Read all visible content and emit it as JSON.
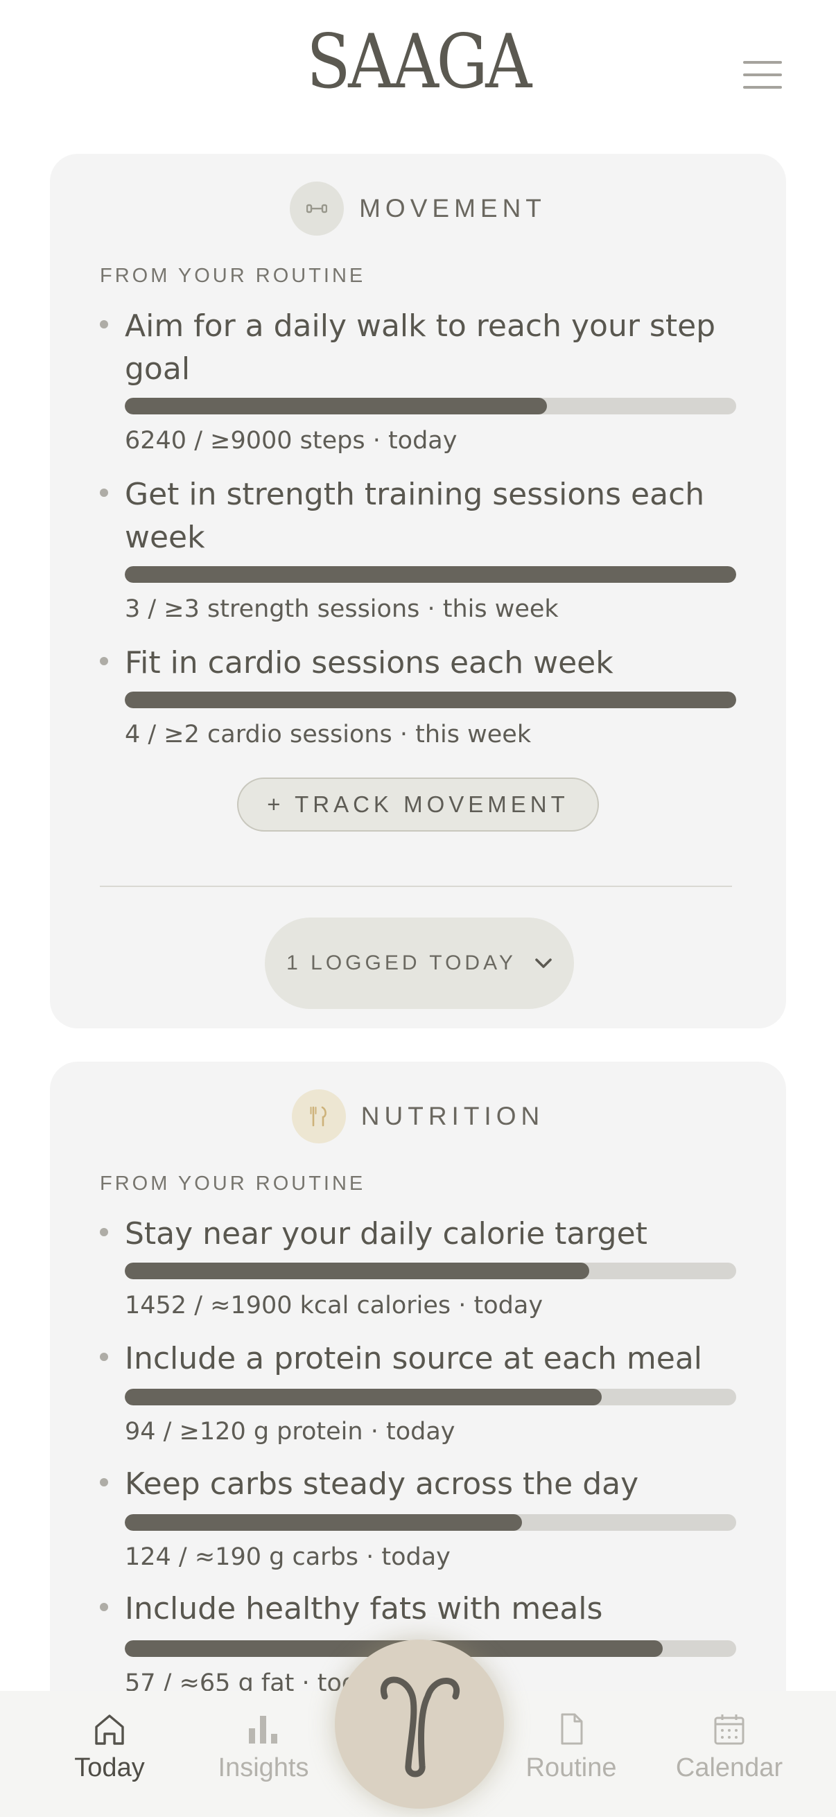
{
  "app": {
    "logo": "SAAGA"
  },
  "movement": {
    "title": "MOVEMENT",
    "section_label": "FROM YOUR ROUTINE",
    "goals": [
      {
        "text": "Aim for a daily walk to reach your step goal",
        "meta": "6240 / ≥9000 steps · today",
        "progress": 0.69
      },
      {
        "text": "Get in strength training sessions each week",
        "meta": "3 / ≥3 strength sessions · this week",
        "progress": 1.0
      },
      {
        "text": "Fit in cardio sessions each week",
        "meta": "4 / ≥2 cardio sessions · this week",
        "progress": 1.0
      }
    ],
    "track_button": "+ TRACK MOVEMENT",
    "logged_button": "1 LOGGED TODAY"
  },
  "nutrition": {
    "title": "NUTRITION",
    "section_label": "FROM YOUR ROUTINE",
    "goals": [
      {
        "text": "Stay near your daily calorie target",
        "meta": "1452 / ≈1900 kcal calories · today",
        "progress": 0.76
      },
      {
        "text": "Include a protein source at each meal",
        "meta": "94 / ≥120 g protein · today",
        "progress": 0.78
      },
      {
        "text": "Keep carbs steady across the day",
        "meta": "124 / ≈190 g carbs · today",
        "progress": 0.65
      },
      {
        "text": "Include healthy fats with meals",
        "meta": "57 / ≈65 g fat · today",
        "progress": 0.88
      }
    ]
  },
  "nav": {
    "items": [
      {
        "label": "Today",
        "active": true
      },
      {
        "label": "Insights",
        "active": false
      },
      {
        "label": "Routine",
        "active": false
      },
      {
        "label": "Calendar",
        "active": false
      }
    ]
  },
  "colors": {
    "accent": "#67645c",
    "track": "#d6d5d1",
    "card": "#f4f4f4",
    "fab": "#dad1c2"
  },
  "icons": {
    "movement": "dumbbell-icon",
    "nutrition": "fork-knife-icon",
    "menu": "hamburger-menu-icon",
    "fab": "saaga-monogram-icon"
  }
}
